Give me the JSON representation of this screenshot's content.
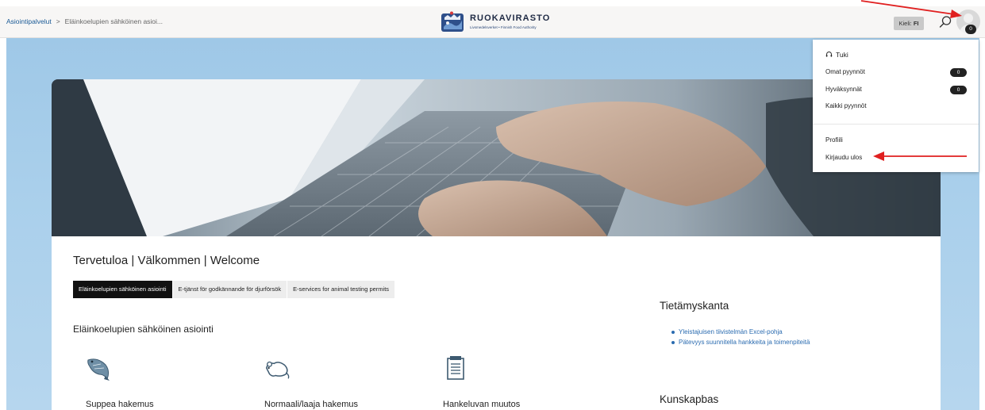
{
  "breadcrumb": {
    "items": [
      "Asiointipalvelut",
      "Eläinkoelupien sähköinen asioi..."
    ],
    "separator": ">"
  },
  "logo": {
    "name": "RUOKAVIRASTO",
    "tagline": "Livsmedelsverket • Finnish Food Authority"
  },
  "header": {
    "language_label": "Kieli:",
    "language_value": "FI",
    "avatar_badge": "0"
  },
  "user_menu": {
    "support": "Tuki",
    "my_requests": "Omat pyynnöt",
    "my_requests_count": "0",
    "approvals": "Hyväksynnät",
    "approvals_count": "0",
    "all_requests": "Kaikki pyynnöt",
    "profile": "Profiili",
    "logout": "Kirjaudu ulos"
  },
  "main": {
    "welcome": "Tervetuloa | Välkommen | Welcome",
    "tabs": [
      {
        "label": "Eläinkoelupien sähköinen asiointi",
        "active": true
      },
      {
        "label": "E-tjänst för godkännande för djurförsök",
        "active": false
      },
      {
        "label": "E-services for animal testing permits",
        "active": false
      }
    ],
    "section_title": "Eläinkoelupien sähköinen asiointi",
    "services": [
      {
        "label": "Suppea hakemus",
        "icon": "fish-icon"
      },
      {
        "label": "Normaali/laaja hakemus",
        "icon": "mouse-icon"
      },
      {
        "label": "Hankeluvan muutos",
        "icon": "document-icon"
      }
    ]
  },
  "knowledge": {
    "title": "Tietämyskanta",
    "links": [
      "Yleistajuisen tiivistelmän Excel-pohja",
      "Pätevyys suunnitella hankkeita ja toimenpiteitä"
    ],
    "second_title": "Kunskapbas"
  },
  "colors": {
    "background_blue": "#a9cfeb",
    "header_bg": "#f7f6f5",
    "link": "#2a6bb0",
    "active_tab": "#111111",
    "annotation": "#e02020"
  }
}
